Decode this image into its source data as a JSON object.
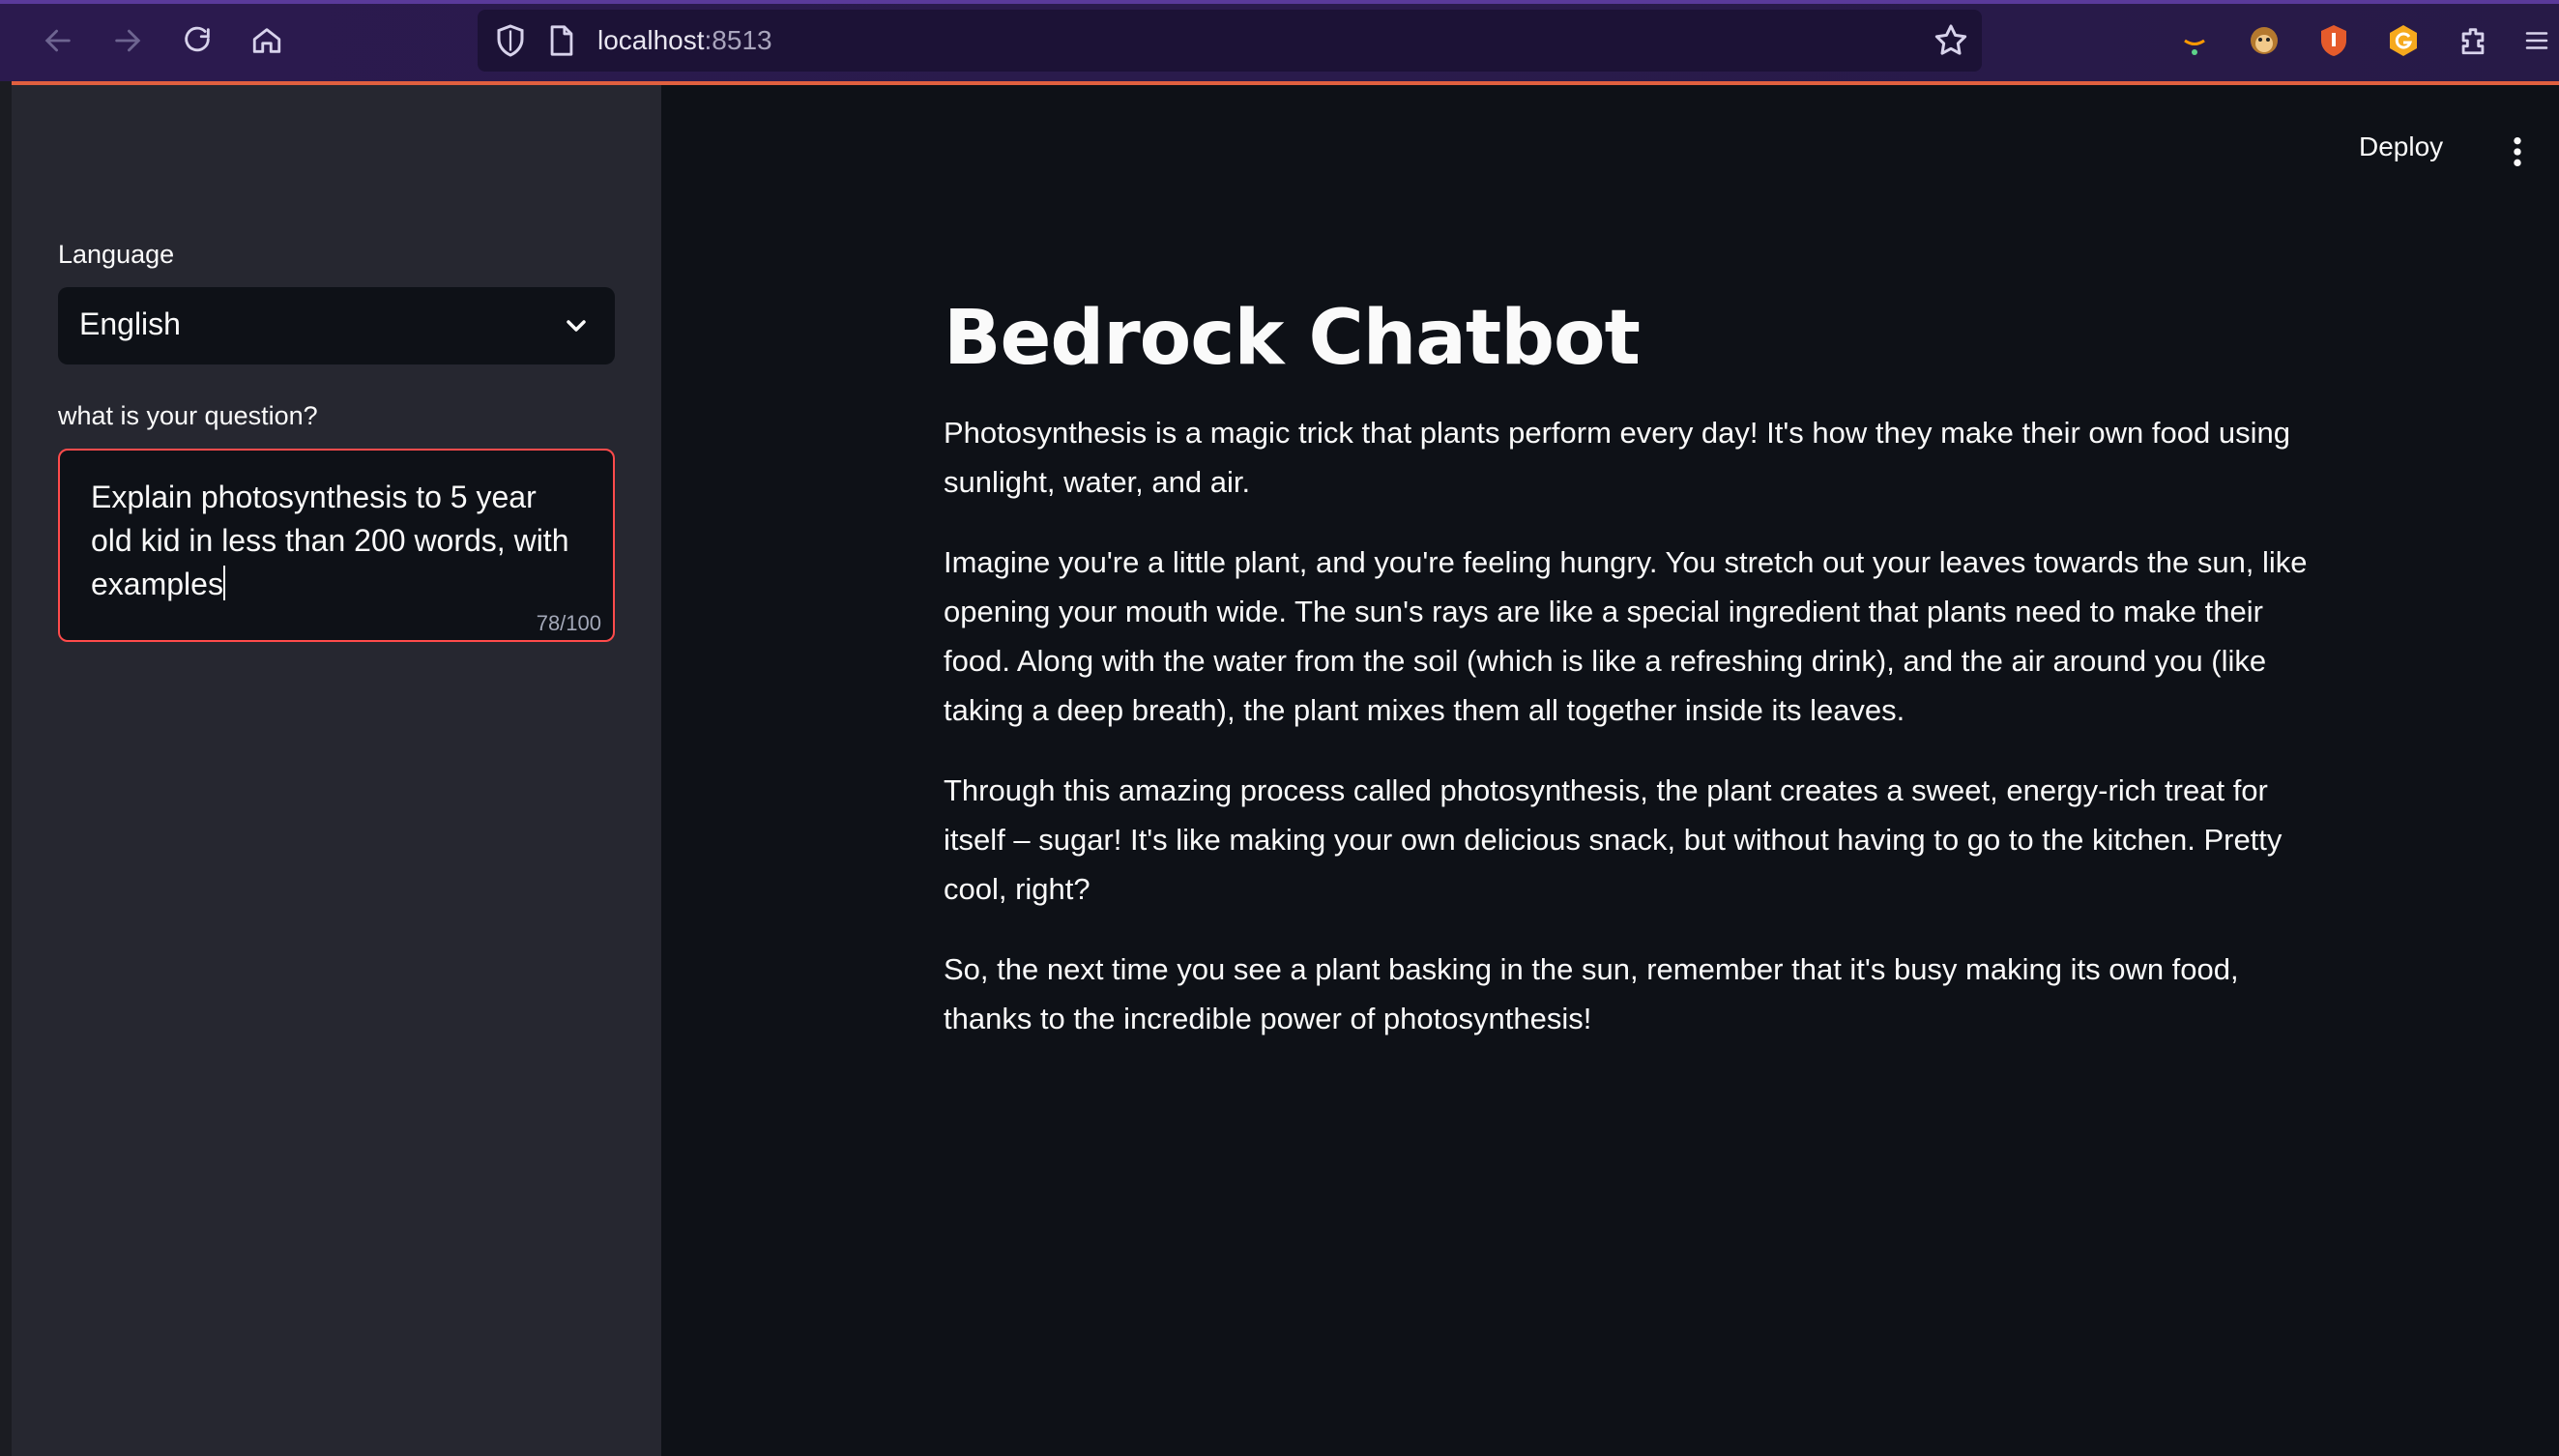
{
  "browser": {
    "url_host": "localhost",
    "url_port": ":8513"
  },
  "sidebar": {
    "language_label": "Language",
    "language_value": "English",
    "question_label": "what is your question?",
    "question_value": "Explain photosynthesis to 5 year old kid in less than 200 words, with examples",
    "char_count": "78/100"
  },
  "header": {
    "deploy_label": "Deploy"
  },
  "main": {
    "title": "Bedrock Chatbot",
    "paragraphs": [
      "Photosynthesis is a magic trick that plants perform every day! It's how they make their own food using sunlight, water, and air.",
      "Imagine you're a little plant, and you're feeling hungry. You stretch out your leaves towards the sun, like opening your mouth wide. The sun's rays are like a special ingredient that plants need to make their food. Along with the water from the soil (which is like a refreshing drink), and the air around you (like taking a deep breath), the plant mixes them all together inside its leaves.",
      "Through this amazing process called photosynthesis, the plant creates a sweet, energy-rich treat for itself – sugar! It's like making your own delicious snack, but without having to go to the kitchen. Pretty cool, right?",
      "So, the next time you see a plant basking in the sun, remember that it's busy making its own food, thanks to the incredible power of photosynthesis!"
    ]
  },
  "colors": {
    "sidebar_bg": "#262730",
    "main_bg": "#0e1117",
    "accent_red": "#ff4b4b"
  }
}
